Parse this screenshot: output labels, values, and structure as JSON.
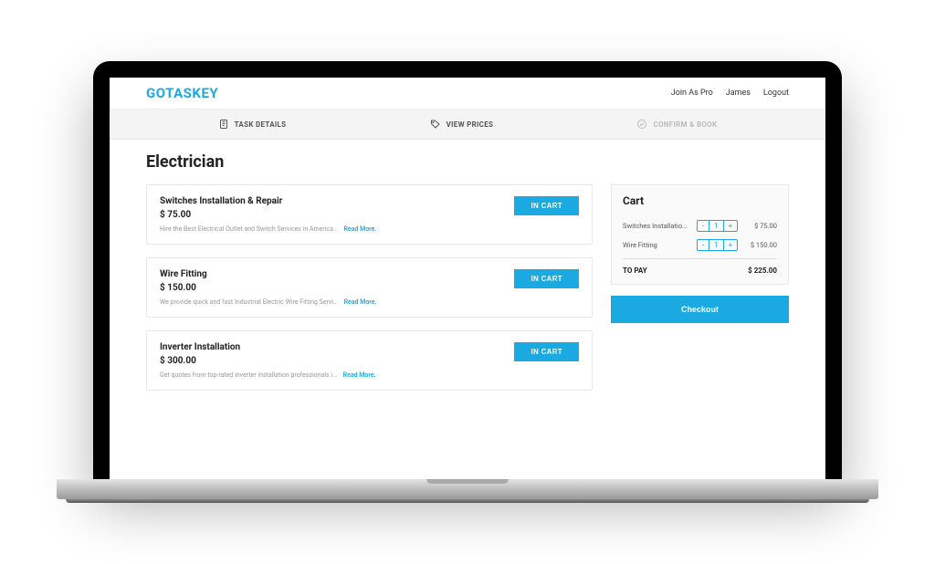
{
  "brand": "GOTASKEY",
  "header_nav": {
    "join": "Join As Pro",
    "user": "James",
    "logout": "Logout"
  },
  "steps": {
    "task_details": "TASK DETAILS",
    "view_prices": "VIEW PRICES",
    "confirm_book": "CONFIRM & BOOK"
  },
  "page_title": "Electrician",
  "services": [
    {
      "title": "Switches Installation & Repair",
      "price": "$ 75.00",
      "desc": "Hire the Best Electrical Outlet and Switch Services in America...",
      "read_more": "Read More.",
      "button": "IN CART"
    },
    {
      "title": "Wire Fitting",
      "price": "$ 150.00",
      "desc": "We provide quick and fast Industrial Electric Wire Fitting Servi...",
      "read_more": "Read More.",
      "button": "IN CART"
    },
    {
      "title": "Inverter Installation",
      "price": "$ 300.00",
      "desc": "Get quotes from top-rated inverter installation professionals i...",
      "read_more": "Read More.",
      "button": "IN CART"
    }
  ],
  "cart": {
    "title": "Cart",
    "items": [
      {
        "name": "Switches Installatio...",
        "qty": "1",
        "amount": "$ 75.00"
      },
      {
        "name": "Wire Fitting",
        "qty": "1",
        "amount": "$ 150.00"
      }
    ],
    "to_pay_label": "TO PAY",
    "to_pay_amount": "$ 225.00",
    "checkout": "Checkout",
    "minus": "-",
    "plus": "+"
  }
}
